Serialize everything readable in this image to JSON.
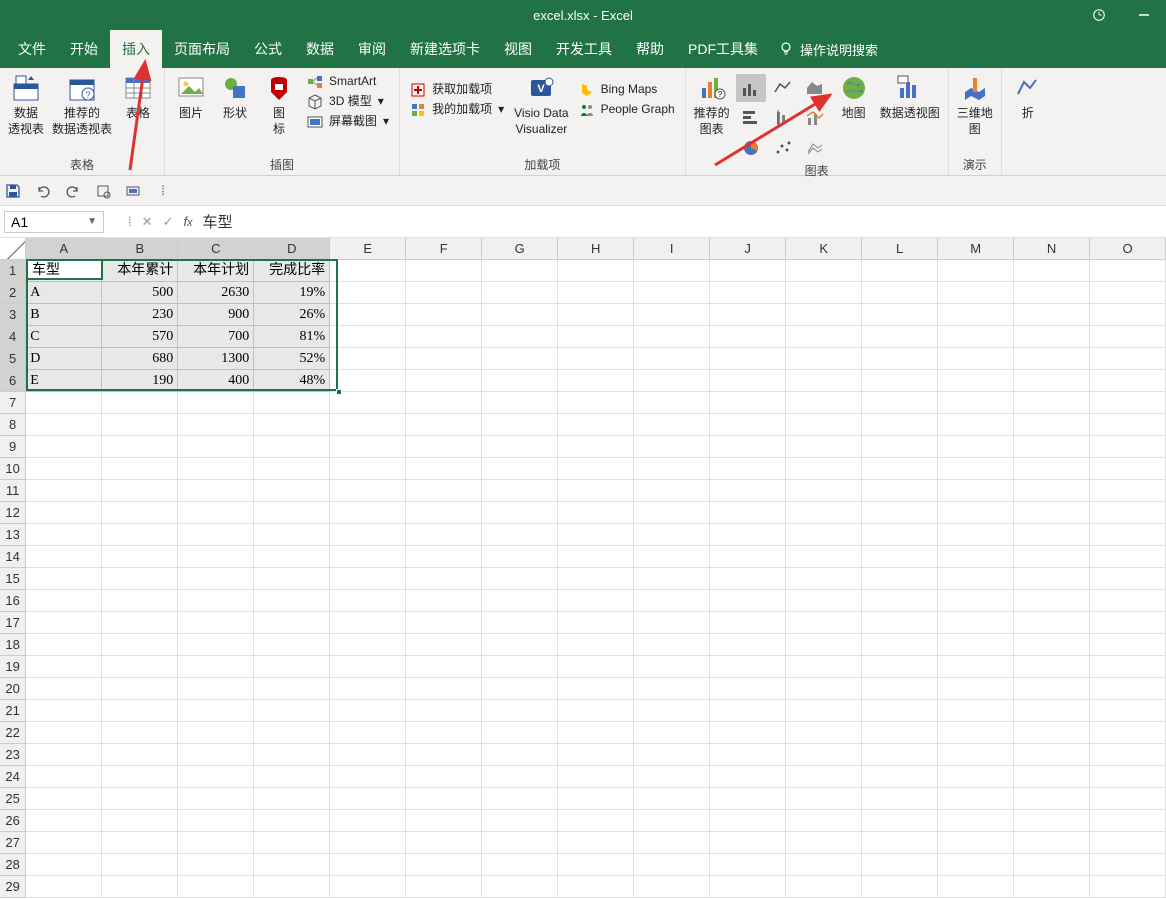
{
  "title": "excel.xlsx  -  Excel",
  "tabs": [
    "文件",
    "开始",
    "插入",
    "页面布局",
    "公式",
    "数据",
    "审阅",
    "新建选项卡",
    "视图",
    "开发工具",
    "帮助",
    "PDF工具集"
  ],
  "active_tab": "插入",
  "tellme": "操作说明搜索",
  "ribbon": {
    "g1_label": "表格",
    "pivot": "数据\n透视表",
    "rec_pivot": "推荐的\n数据透视表",
    "table": "表格",
    "g2_label": "插图",
    "pic": "图片",
    "shapes": "形状",
    "icons": "图\n标",
    "smartart": "SmartArt",
    "model3d": "3D 模型",
    "screenshot": "屏幕截图",
    "g3_label": "加载项",
    "getaddins": "获取加载项",
    "myaddins": "我的加载项",
    "visio": "Visio Data\nVisualizer",
    "bing": "Bing Maps",
    "people": "People Graph",
    "g4_label": "图表",
    "rec_chart": "推荐的\n图表",
    "map": "地图",
    "pivotchart": "数据透视图",
    "g5_label": "演示",
    "map3d": "三维地\n图",
    "spark": "折"
  },
  "namebox": "A1",
  "formula_value": "车型",
  "columns": [
    "A",
    "B",
    "C",
    "D",
    "E",
    "F",
    "G",
    "H",
    "I",
    "J",
    "K",
    "L",
    "M",
    "N",
    "O"
  ],
  "sel_cols": 4,
  "sel_rows": 6,
  "chart_data": {
    "type": "table",
    "headers": [
      "车型",
      "本年累计",
      "本年计划",
      "完成比率"
    ],
    "rows": [
      [
        "A",
        "500",
        "2630",
        "19%"
      ],
      [
        "B",
        "230",
        "900",
        "26%"
      ],
      [
        "C",
        "570",
        "700",
        "81%"
      ],
      [
        "D",
        "680",
        "1300",
        "52%"
      ],
      [
        "E",
        "190",
        "400",
        "48%"
      ]
    ]
  },
  "total_rows": 29
}
